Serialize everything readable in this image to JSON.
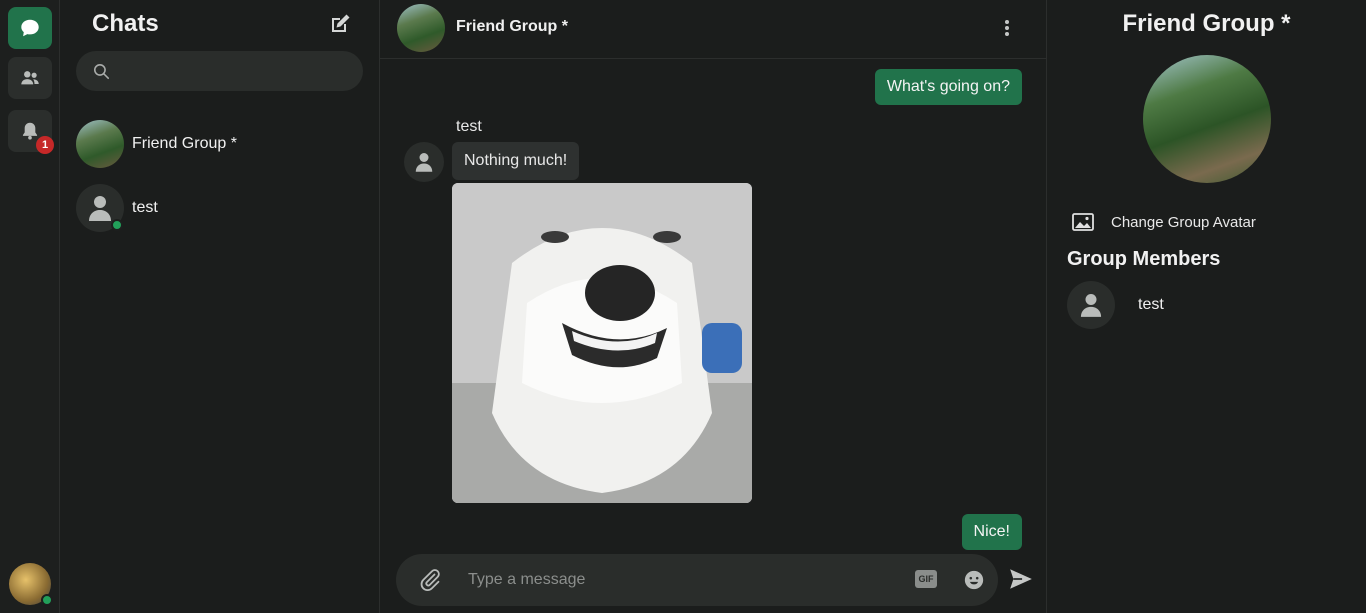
{
  "rail": {
    "items": [
      {
        "name": "chats",
        "icon": "chat-bubble-icon",
        "active": true
      },
      {
        "name": "friends",
        "icon": "people-icon",
        "active": false
      },
      {
        "name": "notifications",
        "icon": "bell-icon",
        "active": false,
        "badge": "1"
      }
    ],
    "user_avatar": "user-avatar"
  },
  "chats": {
    "title": "Chats",
    "search_placeholder": "",
    "items": [
      {
        "name": "Friend Group *",
        "avatar": "landscape"
      },
      {
        "name": "test",
        "avatar": "default-person",
        "online": true
      }
    ]
  },
  "conversation": {
    "title": "Friend Group *",
    "messages": [
      {
        "direction": "out",
        "text": "What's going on?"
      },
      {
        "direction": "in",
        "sender": "test",
        "text": "Nothing much!"
      },
      {
        "direction": "in",
        "type": "image",
        "description": "dog"
      },
      {
        "direction": "out",
        "text": "Nice!"
      }
    ],
    "composer": {
      "placeholder": "Type a message",
      "gif_label": "GIF"
    }
  },
  "info": {
    "title": "Friend Group *",
    "change_avatar_label": "Change Group Avatar",
    "members_title": "Group Members",
    "members": [
      {
        "name": "test"
      }
    ]
  },
  "colors": {
    "accent": "#21734b",
    "background": "#1b1d1c",
    "surface": "#2a2d2b",
    "badge": "#c62828",
    "online": "#22a05a"
  }
}
